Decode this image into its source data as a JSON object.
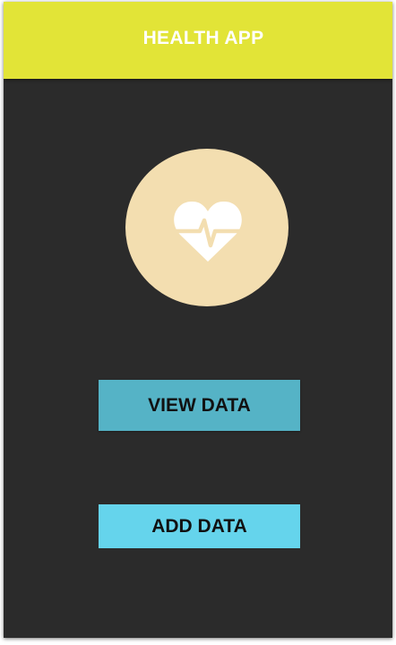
{
  "header": {
    "title": "HEALTH APP",
    "background_color": "#e2e437"
  },
  "logo": {
    "icon": "heart-pulse-icon",
    "circle_color": "#f3deb0"
  },
  "actions": {
    "view_data_label": "VIEW DATA",
    "add_data_label": "ADD DATA",
    "view_color": "#55b3c6",
    "add_color": "#65d4ec"
  },
  "theme": {
    "background": "#2b2b2b"
  }
}
